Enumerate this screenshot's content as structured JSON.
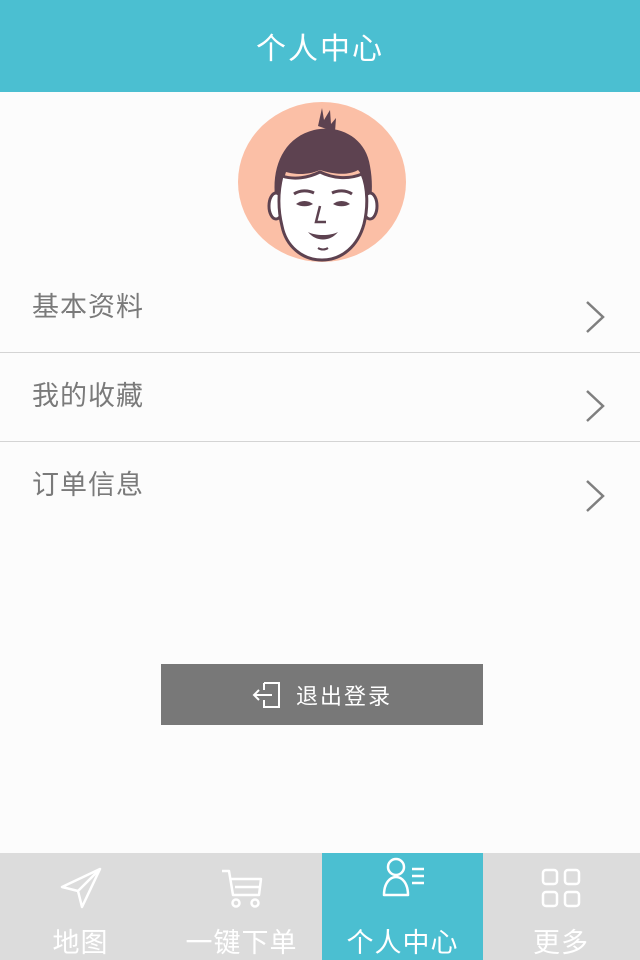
{
  "header": {
    "title": "个人中心"
  },
  "menu": {
    "items": [
      {
        "label": "基本资料"
      },
      {
        "label": "我的收藏"
      },
      {
        "label": "订单信息"
      }
    ]
  },
  "logout": {
    "label": "退出登录"
  },
  "tabbar": {
    "tabs": [
      {
        "label": "地图",
        "icon": "send-icon",
        "active": false
      },
      {
        "label": "一键下单",
        "icon": "cart-icon",
        "active": false
      },
      {
        "label": "个人中心",
        "icon": "person-list-icon",
        "active": true
      },
      {
        "label": "更多",
        "icon": "grid-icon",
        "active": false
      }
    ]
  },
  "colors": {
    "accent": "#4bbfd1",
    "avatar_bg": "#fbbfa6",
    "hair": "#5d4250",
    "logout_bg": "#787878",
    "tabbar_bg": "#dcdcdc"
  }
}
